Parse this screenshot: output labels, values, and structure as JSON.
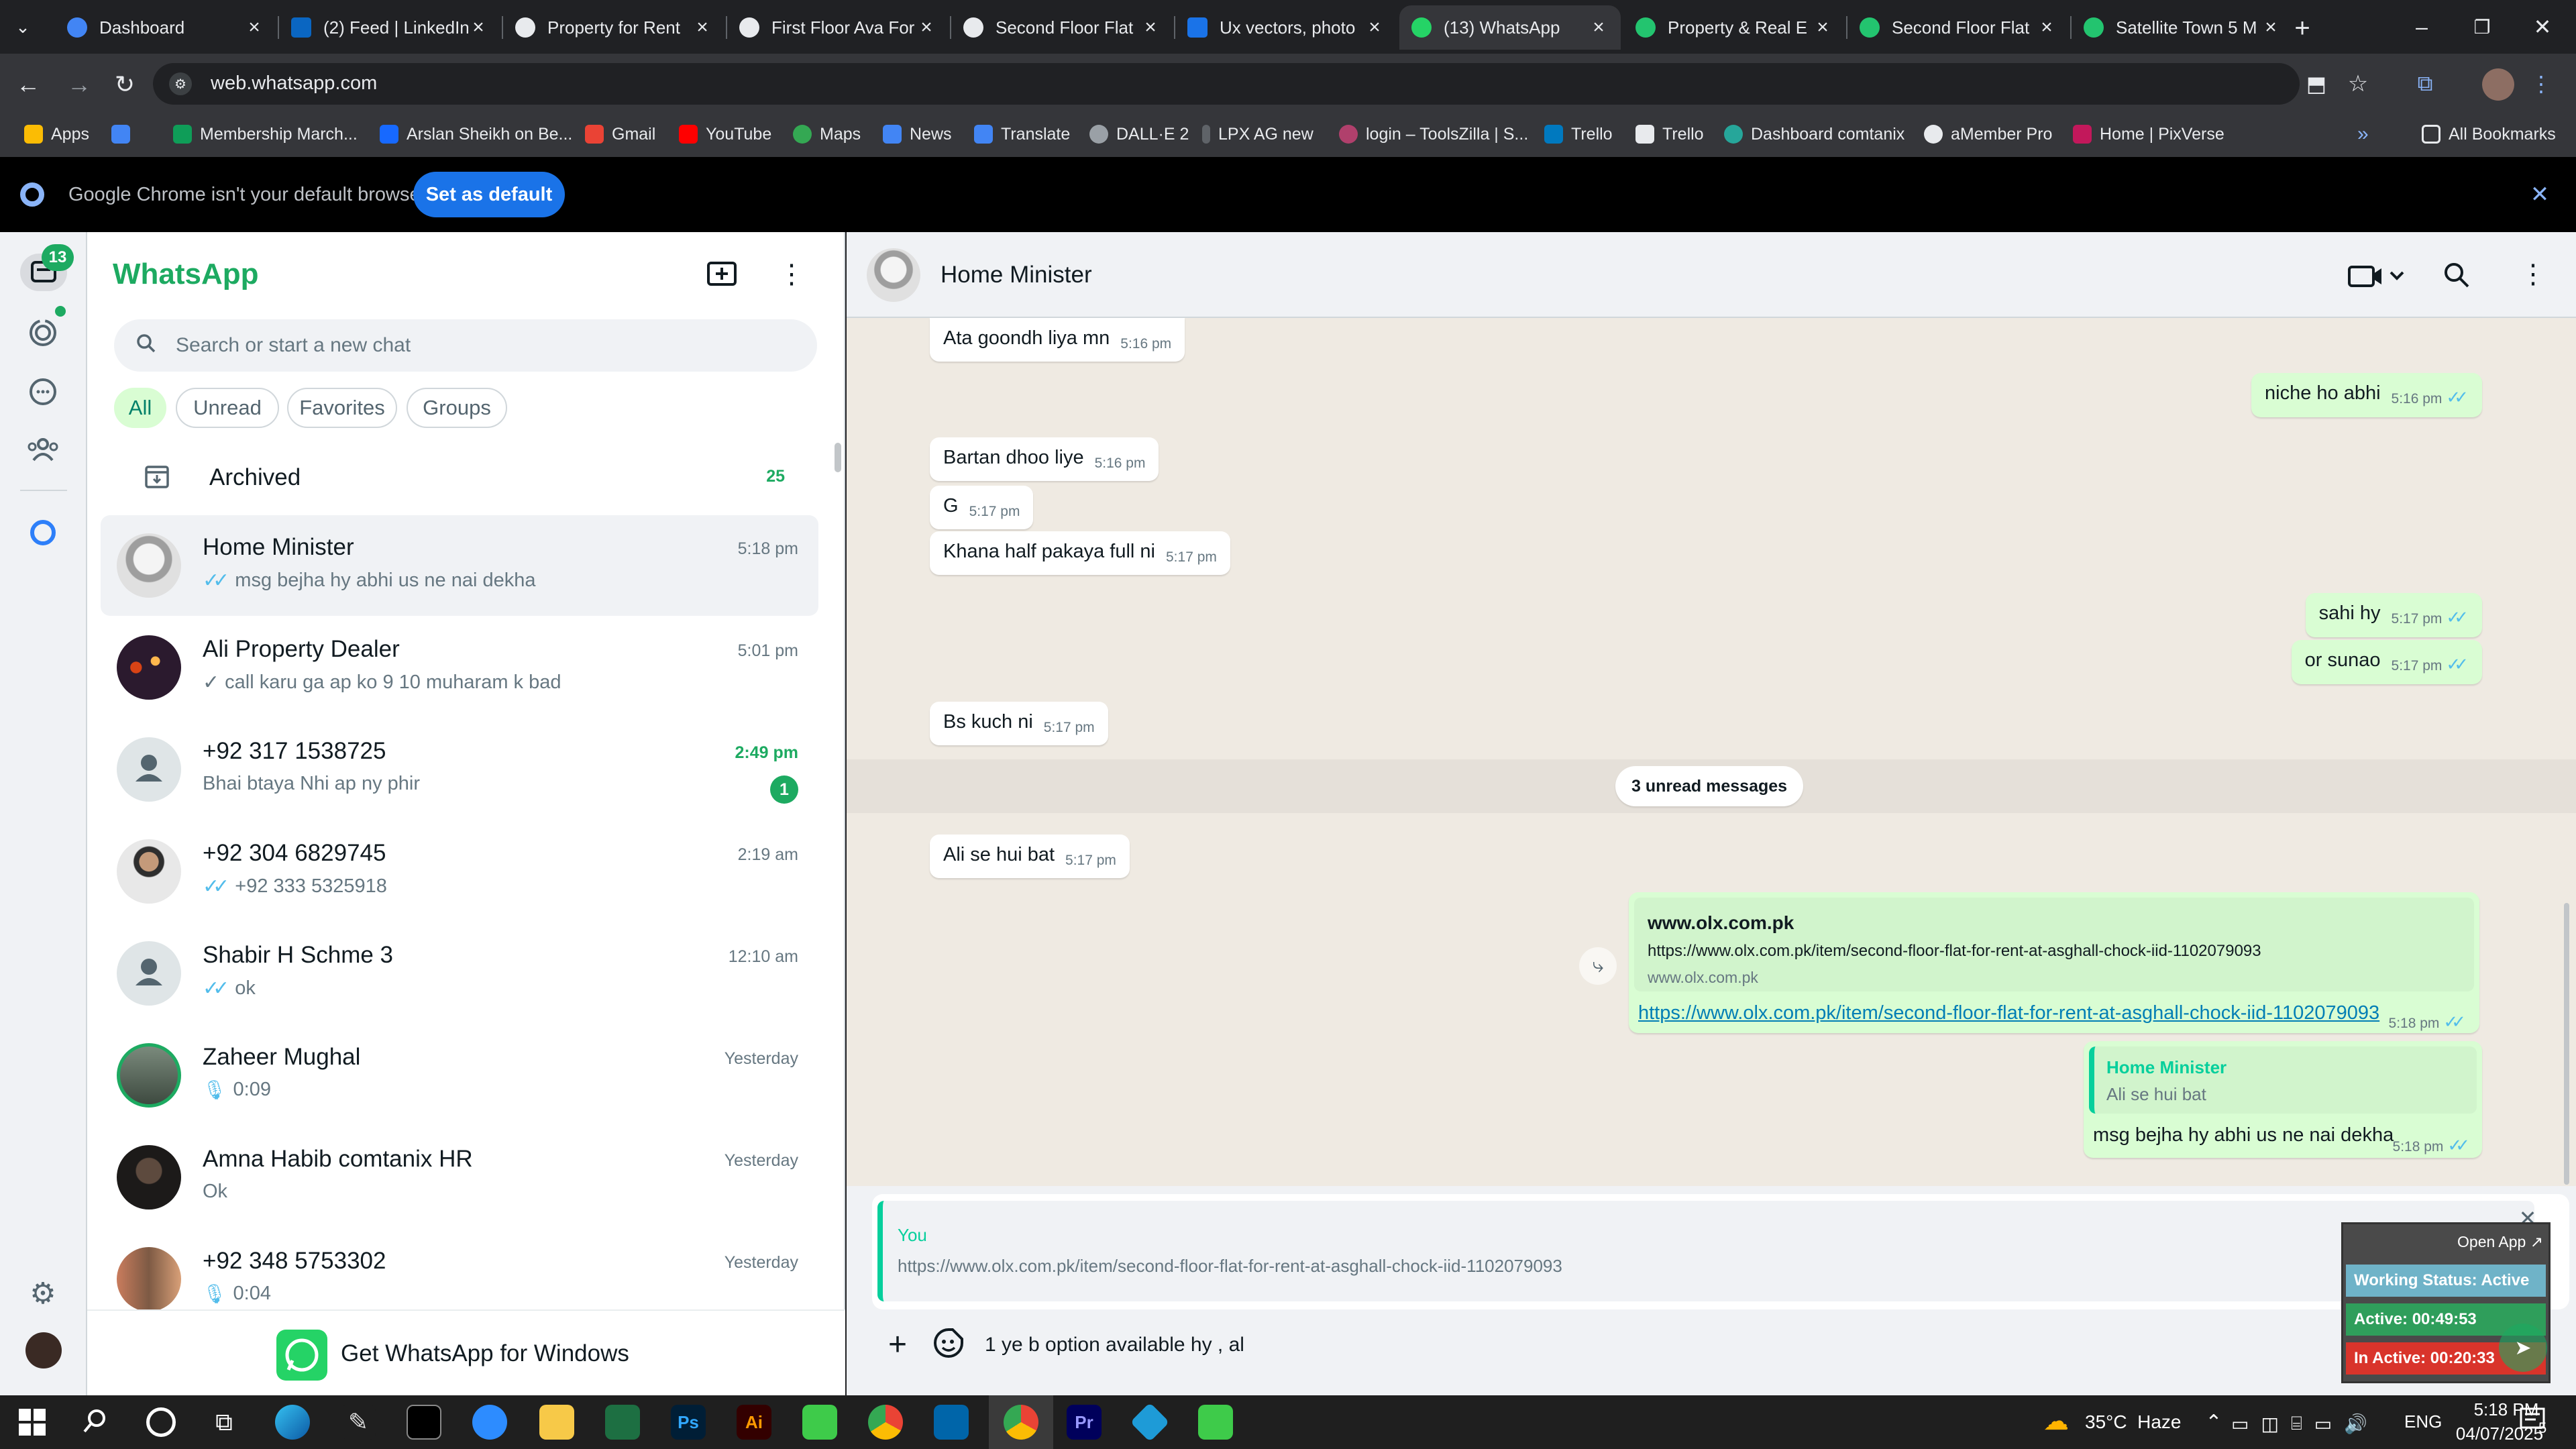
{
  "browser": {
    "tabs": [
      {
        "title": "Dashboard",
        "active": false
      },
      {
        "title": "(2) Feed | LinkedIn",
        "active": false
      },
      {
        "title": "Property for Rent",
        "active": false
      },
      {
        "title": "First Floor Ava For",
        "active": false
      },
      {
        "title": "Second Floor Flat",
        "active": false
      },
      {
        "title": "Ux vectors, photo",
        "active": false
      },
      {
        "title": "(13) WhatsApp",
        "active": true
      },
      {
        "title": "Property & Real E",
        "active": false
      },
      {
        "title": "Second Floor Flat",
        "active": false
      },
      {
        "title": "Satellite Town 5 M",
        "active": false
      }
    ],
    "url": "web.whatsapp.com",
    "bookmarks": [
      "Apps",
      "Membership March...",
      "Arslan Sheikh on Be...",
      "Gmail",
      "YouTube",
      "Maps",
      "News",
      "Translate",
      "DALL·E 2",
      "LPX AG new",
      "login – ToolsZilla | S...",
      "Trello",
      "Trello",
      "Dashboard comtanix",
      "aMember Pro",
      "Home | PixVerse"
    ],
    "all_bookmarks": "All Bookmarks",
    "infobar": {
      "text": "Google Chrome isn't your default browser",
      "button": "Set as default"
    }
  },
  "rail": {
    "unread_badge": "13"
  },
  "sidebar": {
    "title": "WhatsApp",
    "search_placeholder": "Search or start a new chat",
    "filters": [
      "All",
      "Unread",
      "Favorites",
      "Groups"
    ],
    "archived": {
      "label": "Archived",
      "count": "25"
    },
    "chats": [
      {
        "name": "Home Minister",
        "time": "5:18 pm",
        "message": "msg bejha hy abhi us ne nai dekha",
        "tick": "double-blue",
        "selected": true
      },
      {
        "name": "Ali Property Dealer",
        "time": "5:01 pm",
        "message": "call karu ga ap ko 9 10 muharam k bad",
        "tick": "single"
      },
      {
        "name": "+92 317 1538725",
        "time": "2:49 pm",
        "message": "Bhai btaya Nhi ap ny phir",
        "unread": "1"
      },
      {
        "name": "+92 304 6829745",
        "time": "2:19 am",
        "message": "+92 333 5325918",
        "tick": "double-blue"
      },
      {
        "name": "Shabir H  Schme 3",
        "time": "12:10 am",
        "message": "ok",
        "tick": "double-blue"
      },
      {
        "name": "Zaheer Mughal",
        "time": "Yesterday",
        "message": "0:09",
        "voice": true
      },
      {
        "name": "Amna Habib comtanix HR",
        "time": "Yesterday",
        "message": "Ok"
      },
      {
        "name": "+92 348 5753302",
        "time": "Yesterday",
        "message": "0:04",
        "voice": true
      }
    ],
    "promo": "Get WhatsApp for Windows"
  },
  "chat": {
    "contact": "Home Minister",
    "messages": [
      {
        "dir": "in",
        "text": "Ata goondh liya mn",
        "time": "5:16 pm"
      },
      {
        "dir": "out",
        "text": "niche ho abhi",
        "time": "5:16 pm"
      },
      {
        "dir": "in",
        "text": "Bartan dhoo liye",
        "time": "5:16 pm"
      },
      {
        "dir": "in",
        "text": "G",
        "time": "5:17 pm"
      },
      {
        "dir": "in",
        "text": "Khana half pakaya full ni",
        "time": "5:17 pm"
      },
      {
        "dir": "out",
        "text": "sahi hy",
        "time": "5:17 pm"
      },
      {
        "dir": "out",
        "text": "or sunao",
        "time": "5:17 pm"
      },
      {
        "dir": "in",
        "text": "Bs kuch ni",
        "time": "5:17 pm"
      },
      {
        "dir": "in",
        "text": "Ali se hui bat",
        "time": "5:17 pm"
      }
    ],
    "unread_divider": "3 unread messages",
    "link_preview": {
      "site": "www.olx.com.pk",
      "url": "https://www.olx.com.pk/item/second-floor-flat-for-rent-at-asghall-chock-iid-1102079093",
      "domain": "www.olx.com.pk",
      "link": "https://www.olx.com.pk/item/second-floor-flat-for-rent-at-asghall-chock-iid-1102079093",
      "time": "5:18 pm"
    },
    "reply_message": {
      "quoted_author": "Home Minister",
      "quoted_text": "Ali se hui bat",
      "text": "msg bejha hy abhi us ne nai dekha",
      "time": "5:18 pm"
    },
    "composer": {
      "reply_author": "You",
      "reply_text": "https://www.olx.com.pk/item/second-floor-flat-for-rent-at-asghall-chock-iid-1102079093",
      "draft": "1 ye b option available hy , al"
    }
  },
  "tracker": {
    "open_app": "Open App ↗",
    "status": "Working Status: Active",
    "active": "Active: 00:49:53",
    "inactive": "In Active: 00:20:33"
  },
  "taskbar": {
    "weather": "35°C  Haze",
    "language": "ENG",
    "time": "5:18 PM",
    "date": "04/07/2025",
    "notifications": "5"
  },
  "colors": {
    "accent": "#1daa61",
    "tick": "#53bdeb",
    "outgoing_bubble": "#d9fdd3",
    "chrome_dark": "#202124"
  }
}
